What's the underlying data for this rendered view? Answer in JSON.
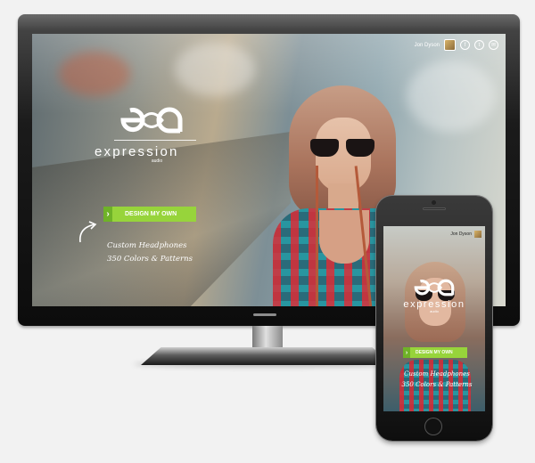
{
  "site": {
    "user": {
      "name": "Jon Dyson"
    },
    "social_icons": [
      "facebook-icon",
      "twitter-icon",
      "email-icon"
    ],
    "social_glyphs": {
      "facebook": "f",
      "twitter": "t",
      "email": "✉"
    },
    "brand": {
      "name": "expression",
      "sub": "audio",
      "mark_text": "ea"
    },
    "cta": {
      "label": "DESIGN MY OWN",
      "chevron": "›"
    },
    "tagline": [
      "Custom Headphones",
      "350 Colors & Patterns"
    ]
  },
  "colors": {
    "accent": "#97d43b",
    "accent_dark": "#6fb228",
    "bezel": "#111111",
    "background": "#f2f2f2"
  }
}
